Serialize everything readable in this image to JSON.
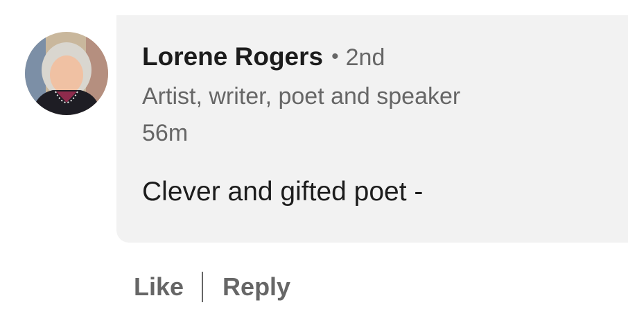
{
  "comment": {
    "author": {
      "name": "Lorene Rogers",
      "separator": "•",
      "degree": "2nd",
      "headline": "Artist, writer, poet and speaker",
      "avatar": "user-avatar-photo"
    },
    "timestamp": "56m",
    "text": "Clever and gifted poet -",
    "bubble_color": "#f2f2f2"
  },
  "actions": {
    "like_label": "Like",
    "divider": "|",
    "reply_label": "Reply"
  },
  "colors": {
    "primary_text": "#1c1c1c",
    "secondary_text": "#666666",
    "background": "#ffffff"
  }
}
